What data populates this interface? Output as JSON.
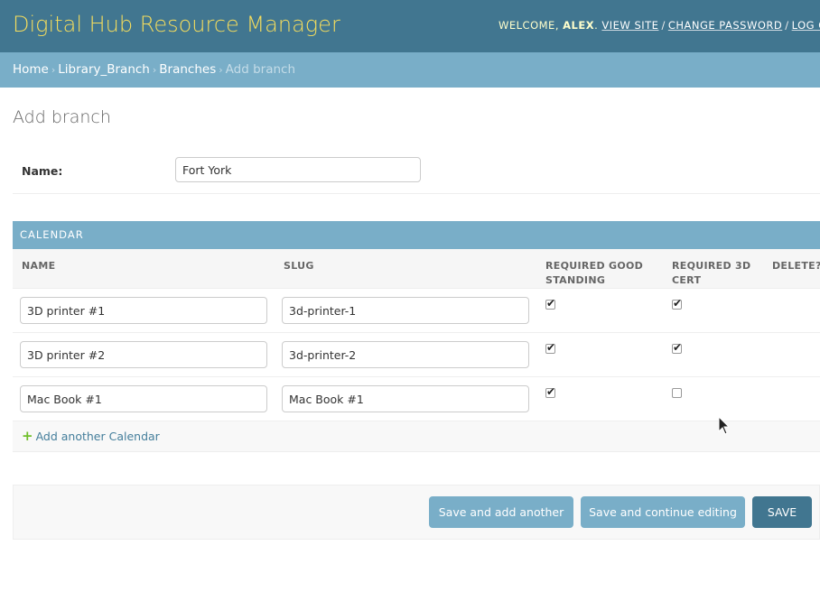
{
  "header": {
    "site_name": "Digital Hub Resource Manager",
    "welcome": "Welcome,",
    "username": "Alex",
    "links": [
      "View site",
      "Change password",
      "Log out"
    ]
  },
  "breadcrumbs": [
    "Home",
    "Library_Branch",
    "Branches",
    "Add branch"
  ],
  "page_title": "Add branch",
  "form": {
    "name_label": "Name:",
    "name_value": "Fort York"
  },
  "inline": {
    "caption": "Calendar",
    "columns": [
      "Name",
      "Slug",
      "Required good standing",
      "Required 3D cert",
      "Delete?"
    ],
    "rows": [
      {
        "name": "3D printer #1",
        "slug": "3d-printer-1",
        "good_standing": true,
        "cert": true
      },
      {
        "name": "3D printer #2",
        "slug": "3d-printer-2",
        "good_standing": true,
        "cert": true
      },
      {
        "name": "Mac Book #1",
        "slug": "Mac Book #1",
        "good_standing": true,
        "cert": false
      }
    ],
    "add_label": "Add another Calendar"
  },
  "buttons": {
    "save_add": "Save and add another",
    "save_continue": "Save and continue editing",
    "save": "SAVE"
  },
  "colors": {
    "header_bg": "#417690",
    "breadcrumb_bg": "#79aec8",
    "brand_text": "#f5dd5d",
    "add_plus": "#70bf2b"
  },
  "icons": [
    "plus-icon",
    "checkmark-icon",
    "mouse-cursor-icon"
  ]
}
